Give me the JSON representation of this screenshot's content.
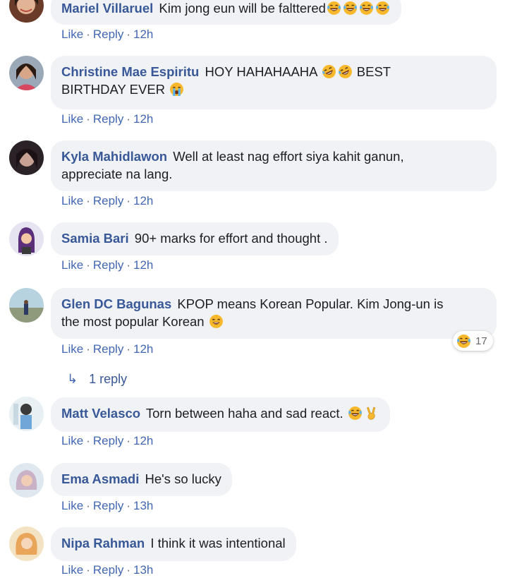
{
  "actions": {
    "like": "Like",
    "reply": "Reply",
    "separator": "·"
  },
  "comments": [
    {
      "author": "Mariel Villaruel",
      "text": "Kim jong eun will be falttered",
      "time": "12h"
    },
    {
      "author": "Christine Mae Espiritu",
      "text_1": "HOY HAHAHAAHA",
      "text_2": "BEST",
      "text_3": "BIRTHDAY EVER",
      "time": "12h"
    },
    {
      "author": "Kyla Mahidlawon",
      "text_1": "Well at least nag effort siya kahit ganun,",
      "text_2": "appreciate na lang.",
      "time": "12h"
    },
    {
      "author": "Samia Bari",
      "text": "90+ marks for effort and thought .",
      "time": "12h"
    },
    {
      "author": "Glen DC Bagunas",
      "text_1": "KPOP means Korean Popular. Kim Jong-un is",
      "text_2": "the most popular Korean",
      "time": "12h",
      "reaction_count": "17",
      "replies_label": "1 reply"
    },
    {
      "author": "Matt Velasco",
      "text": "Torn between haha and sad react.",
      "time": "12h"
    },
    {
      "author": "Ema Asmadi",
      "text": "He's so lucky",
      "time": "13h"
    },
    {
      "author": "Nipa Rahman",
      "text": "I think it was intentional",
      "time": "13h"
    }
  ],
  "icons": {
    "laugh": "tears-of-joy-emoji",
    "rofl": "rolling-laughing-emoji",
    "cry": "crying-emoji",
    "smile": "smiling-emoji",
    "victory": "victory-hand-emoji",
    "reply_arrow": "reply-arrow-icon"
  },
  "colors": {
    "author": "#385898",
    "bubble": "#f0f2f5",
    "meta": "#4267b2"
  }
}
